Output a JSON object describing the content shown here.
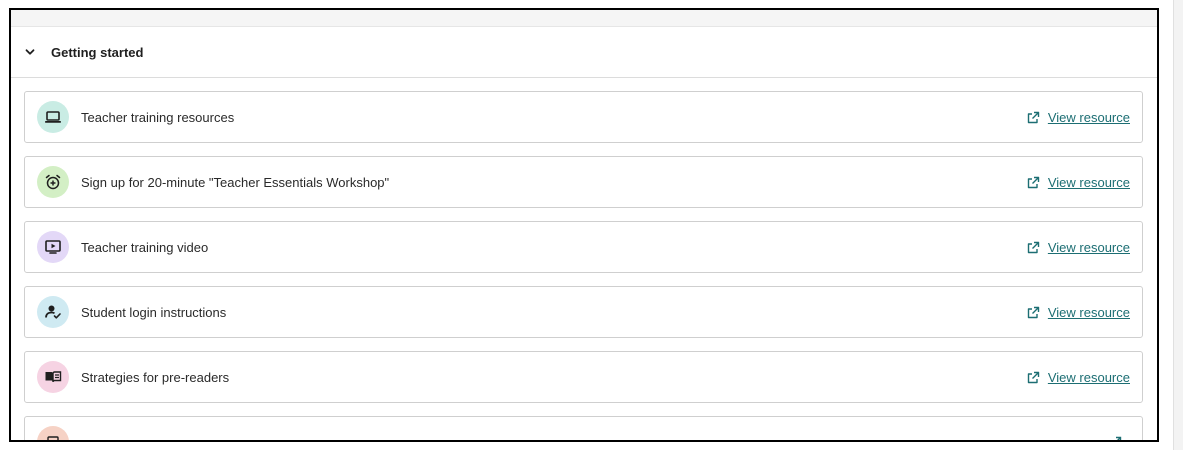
{
  "section": {
    "title": "Getting started",
    "expanded": true
  },
  "resources": [
    {
      "label": "Teacher training resources",
      "icon": "laptop-icon",
      "icon_bg": "#c9ece4",
      "link_label": "View resource"
    },
    {
      "label": "Sign up for 20-minute \"Teacher Essentials Workshop\"",
      "icon": "alarm-clock-icon",
      "icon_bg": "#d3efc5",
      "link_label": "View resource"
    },
    {
      "label": "Teacher training video",
      "icon": "video-play-icon",
      "icon_bg": "#e3d8f7",
      "link_label": "View resource"
    },
    {
      "label": "Student login instructions",
      "icon": "user-check-icon",
      "icon_bg": "#cfeaf2",
      "link_label": "View resource"
    },
    {
      "label": "Strategies for pre-readers",
      "icon": "book-open-icon",
      "icon_bg": "#f6d3e3",
      "link_label": "View resource"
    },
    {
      "label": "",
      "icon": "partial-icon",
      "icon_bg": "#f6d2c5",
      "link_label": ""
    }
  ],
  "colors": {
    "link": "#1c6e73",
    "icon_stroke": "#1f1f1f"
  }
}
